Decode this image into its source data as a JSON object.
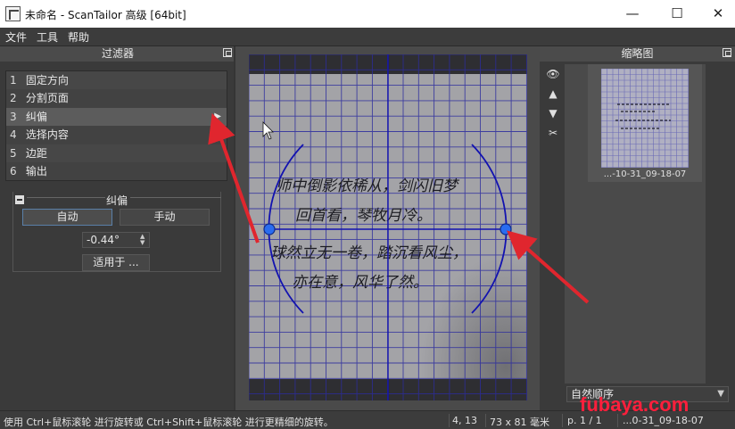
{
  "window": {
    "title": "未命名 - ScanTailor 高级 [64bit]",
    "minimize": "—",
    "maximize": "☐",
    "close": "✕"
  },
  "menu": [
    "文件",
    "工具",
    "帮助"
  ],
  "filters_panel": {
    "title": "过滤器",
    "items": [
      {
        "num": "1",
        "label": "固定方向"
      },
      {
        "num": "2",
        "label": "分割页面"
      },
      {
        "num": "3",
        "label": "纠偏"
      },
      {
        "num": "4",
        "label": "选择内容"
      },
      {
        "num": "5",
        "label": "边距"
      },
      {
        "num": "6",
        "label": "输出"
      }
    ],
    "selected_index": 2
  },
  "deskew": {
    "group_title": "纠偏",
    "auto_label": "自动",
    "manual_label": "手动",
    "angle_value": "-0.44°",
    "apply_label": "适用于 ..."
  },
  "thumbnails_panel": {
    "title": "缩略图",
    "thumb_caption": "...-10-31_09-18-07",
    "sort_value": "自然顺序",
    "icons": [
      "eye-icon",
      "arrow-up-icon",
      "arrow-down-icon",
      "scissors-icon"
    ]
  },
  "handwriting": {
    "line1": "师中倒影依稀从，剑闪旧梦",
    "line2": "回首看，琴牧月冷。",
    "line3": "球然立无一卷，踏沉看风尘，",
    "line4": "亦在意，风华了然。"
  },
  "statusbar": {
    "hint": "使用 Ctrl+鼠标滚轮 进行旋转或 Ctrl+Shift+鼠标滚轮 进行更精细的旋转。",
    "coords": "4, 13",
    "size": "73 x 81 毫米",
    "page": "p. 1 / 1",
    "file": "...0-31_09-18-07"
  },
  "watermark": "fubaya.com",
  "colors": {
    "accent_red": "#e0262e",
    "guide_blue": "#1a1aa8",
    "panel_bg": "#3a3a3a"
  }
}
